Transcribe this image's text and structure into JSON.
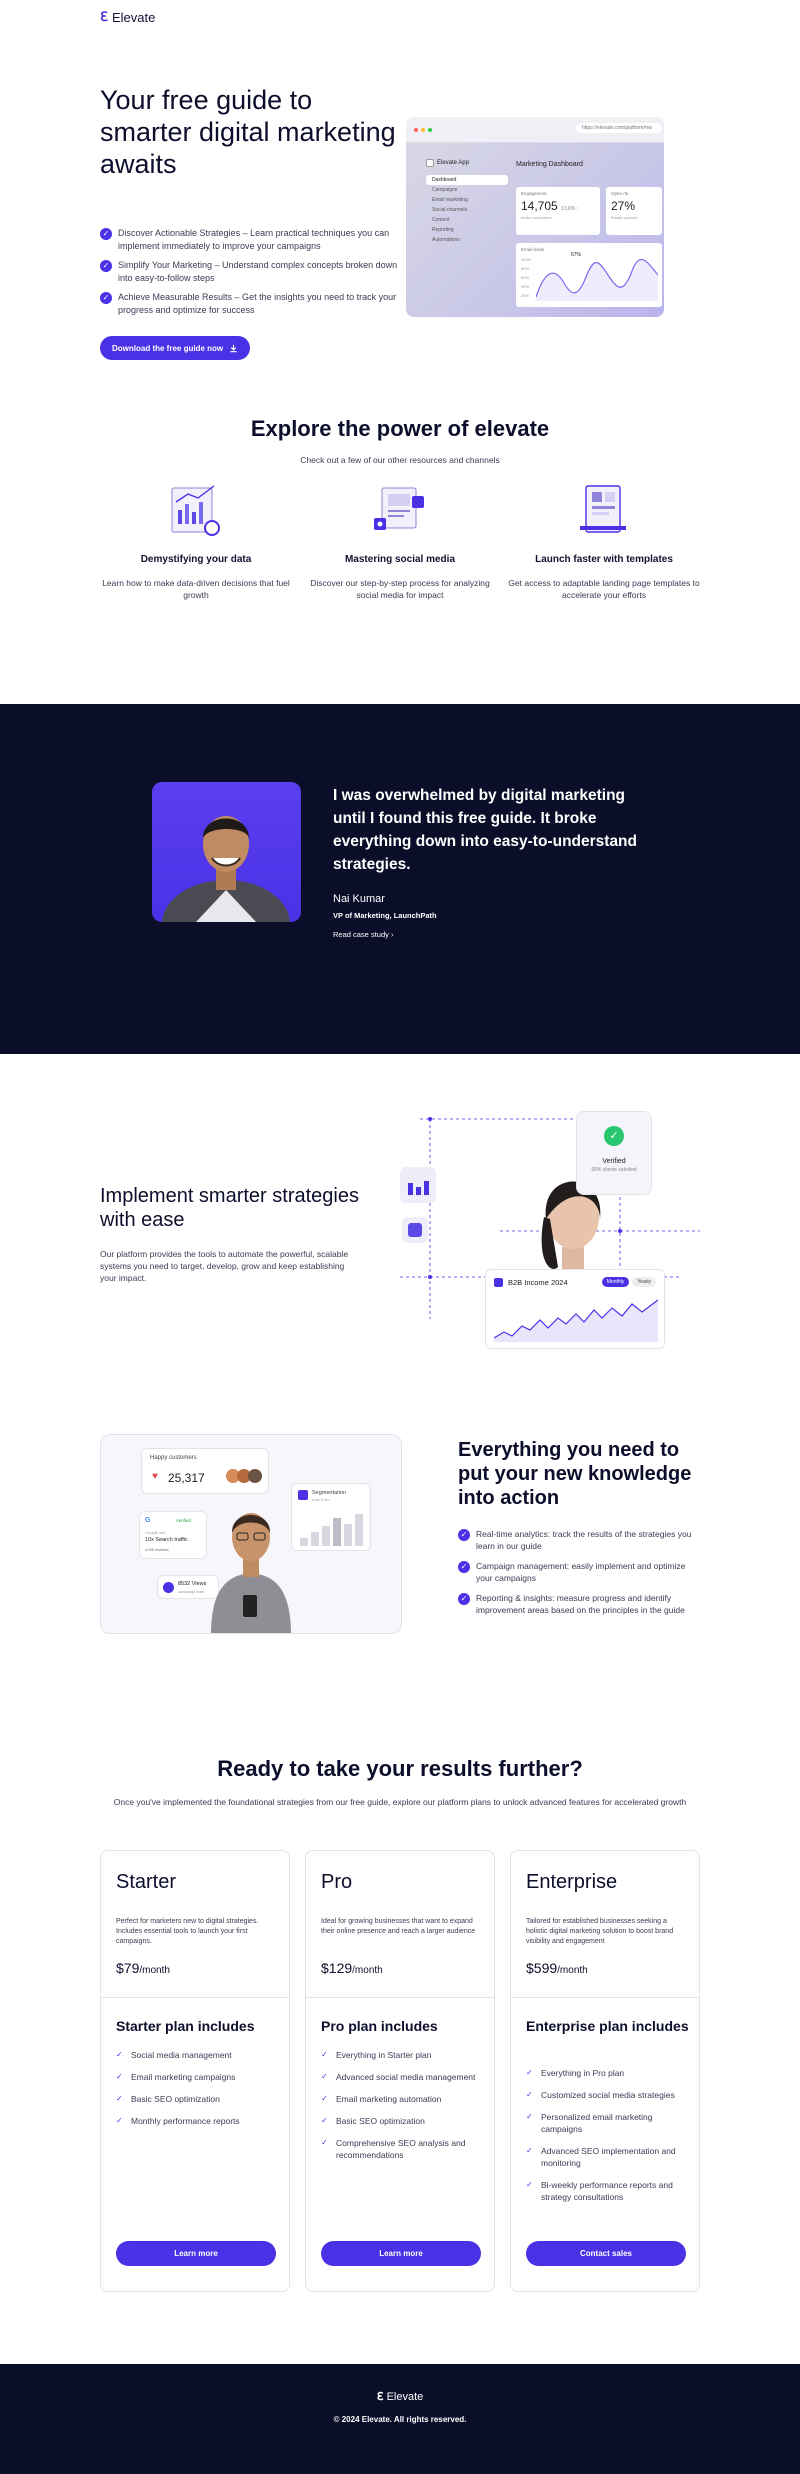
{
  "brand": {
    "name": "Elevate",
    "mark": "ℇ"
  },
  "colors": {
    "accent": "#4b31e6",
    "dark": "#0a0e29",
    "text": "#0d0e2c"
  },
  "hero": {
    "title": "Your free guide to smarter digital marketing awaits",
    "points": [
      "Discover Actionable Strategies – Learn practical techniques you can implement immediately to improve your campaigns",
      "Simplify Your Marketing – Understand complex concepts broken down into easy-to-follow steps",
      "Achieve Measurable Results – Get the insights you need to track your progress and optimize for success"
    ],
    "cta": "Download the free guide now",
    "cta_icon": "download-icon",
    "mockup": {
      "url": "https://elevate.com/platform/rea",
      "app_name": "Elevate App",
      "title": "Marketing Dashboard",
      "nav": [
        "Dashboard",
        "Campaigns",
        "Email marketing",
        "Social channels",
        "Content",
        "Reporting",
        "Automations"
      ],
      "card1": {
        "label": "Engagement",
        "value": "14,705",
        "delta": "13.6% ↑",
        "sub": "Active customers"
      },
      "card2": {
        "label": "Open rte",
        "value": "27%",
        "sub": "Emails opened"
      },
      "chart_label": "Email leads",
      "chart_peak": "67%",
      "chart_ticks": [
        "100%",
        "80%",
        "60%",
        "40%",
        "20%"
      ]
    }
  },
  "explore": {
    "title": "Explore the power of elevate",
    "subtitle": "Check out a few of our other resources and channels",
    "features": [
      {
        "icon": "data-chart-icon",
        "title": "Demystifying your data",
        "desc": "Learn how to make data-driven decisions that fuel growth"
      },
      {
        "icon": "social-media-icon",
        "title": "Mastering social media",
        "desc": "Discover our step-by-step process for analyzing social media for impact"
      },
      {
        "icon": "template-icon",
        "title": "Launch faster with templates",
        "desc": "Get access to adaptable landing page templates to accelerate your efforts"
      }
    ]
  },
  "testimonial": {
    "quote": "I was overwhelmed by digital marketing until I found this free guide. It broke everything down into easy-to-understand strategies.",
    "author": "Nai Kumar",
    "role": "VP of Marketing, LaunchPath",
    "link": "Read case study"
  },
  "smarter": {
    "title": "Implement smarter strategies with ease",
    "desc": "Our platform provides the tools to automate the powerful, scalable systems you need to target, develop, grow and keep establishing your impact.",
    "verified_title": "Verified",
    "verified_sub": "95% clients satisfied",
    "income_title": "B2B Income 2024",
    "income_tabs": [
      "Monthly",
      "Yearly"
    ]
  },
  "everything": {
    "title": "Everything you need to put your new knowledge into action",
    "points": [
      "Real-time analytics: track the results of the strategies you learn in our guide",
      "Campaign management: easily implement and optimize your campaigns",
      "Reporting & insights: measure progress and identify improvement areas based on the principles in the guide"
    ],
    "card": {
      "happy_label": "Happy customers",
      "happy_value": "25,317",
      "seg_label": "Segmentation",
      "seg_sub": "Last 6 mo",
      "verified": "Verified",
      "google_sub": "Google ads",
      "traffic": "10x Search traffic",
      "rating": "4.9/5 reviews",
      "views": "8532 Views",
      "views_sub": "campaign total"
    }
  },
  "pricing": {
    "title": "Ready to take your results further?",
    "subtitle": "Once you've implemented the foundational strategies from our free guide, explore our platform plans to unlock advanced features for accelerated growth",
    "plans": [
      {
        "name": "Starter",
        "desc": "Perfect for marketers new to digital strategies. Includes essential tools to launch your first campaigns.",
        "price": "$79",
        "period": "/month",
        "includes": "Starter plan includes",
        "features": [
          "Social media management",
          "Email marketing campaigns",
          "Basic SEO optimization",
          "Monthly performance reports"
        ],
        "button": "Learn more"
      },
      {
        "name": "Pro",
        "desc": "Ideal for growing businesses that want to expand their online presence and reach a larger audience",
        "price": "$129",
        "period": "/month",
        "includes": "Pro plan includes",
        "features": [
          "Everything in Starter plan",
          "Advanced social media management",
          "Email marketing automation",
          "Basic SEO optimization",
          "Comprehensive SEO analysis and recommendations"
        ],
        "button": "Learn more"
      },
      {
        "name": "Enterprise",
        "desc": "Tailored for established businesses seeking a holistic digital marketing solution to boost brand visibility and engagement",
        "price": "$599",
        "period": "/month",
        "includes": "Enterprise plan includes",
        "features": [
          "Everything in Pro plan",
          "Customized social media strategies",
          "Personalized email marketing campaigns",
          "Advanced SEO implementation and monitoring",
          "Bi-weekly performance reports and strategy consultations"
        ],
        "button": "Contact sales"
      }
    ]
  },
  "footer": {
    "copyright": "© 2024 Elevate. All rights reserved."
  }
}
